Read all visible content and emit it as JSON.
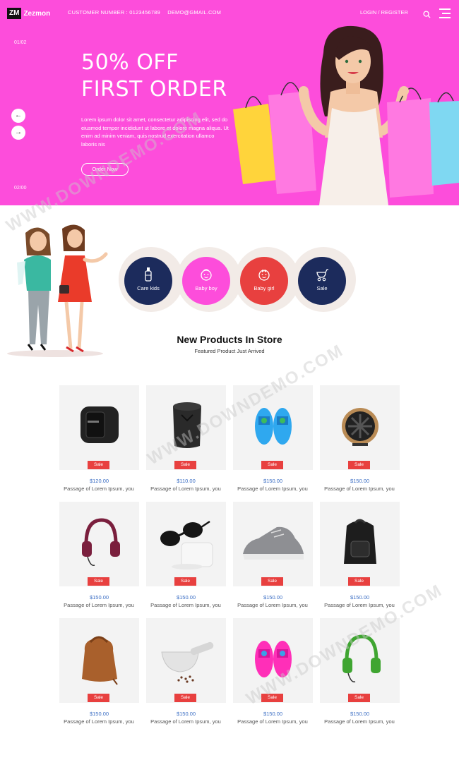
{
  "brand": {
    "mark": "ZM",
    "name": "Zezmon"
  },
  "topbar": {
    "customer_number": "CUSTOMER NUMBER : 0123456789",
    "email": "DEMO@GMAIL.COM",
    "login": "LOGIN / REGISTER"
  },
  "hero": {
    "slide_top": "01/02",
    "slide_bottom": "02/00",
    "title_line1": "50% OFF",
    "title_line2": "FIRST ORDER",
    "text": "Lorem ipsum dolor sit amet, consectetur adipiscing elit, sed do eiusmod tempor incididunt ut labore et dolore magna aliqua. Ut enim ad minim veniam, quis nostrud exercitation ullamco laboris nis",
    "button": "Order Now",
    "prev_arrow": "←",
    "next_arrow": "→"
  },
  "categories": [
    {
      "label": "Care kids",
      "color": "#1c2b5c",
      "icon": "bottle-icon"
    },
    {
      "label": "Baby boy",
      "color": "#fd4ddb",
      "icon": "baby-face-icon"
    },
    {
      "label": "Baby girl",
      "color": "#e8403f",
      "icon": "baby-face-icon"
    },
    {
      "label": "Sale",
      "color": "#1c2b5c",
      "icon": "stroller-icon"
    }
  ],
  "section": {
    "title": "New Products In Store",
    "subtitle": "Featured Product Just Arrived"
  },
  "products": [
    {
      "name": "smartwatch",
      "badge": "Sale",
      "price": "$120.00",
      "desc": "Passage of Lorem Ipsum, you"
    },
    {
      "name": "speaker",
      "badge": "Sale",
      "price": "$110.00",
      "desc": "Passage of Lorem Ipsum, you"
    },
    {
      "name": "blue-slippers",
      "badge": "Sale",
      "price": "$150.00",
      "desc": "Passage of Lorem Ipsum, you"
    },
    {
      "name": "fan",
      "badge": "Sale",
      "price": "$150.00",
      "desc": "Passage of Lorem Ipsum, you"
    },
    {
      "name": "headphones-maroon",
      "badge": "Sale",
      "price": "$150.00",
      "desc": "Passage of Lorem Ipsum, you"
    },
    {
      "name": "sunglasses",
      "badge": "Sale",
      "price": "$150.00",
      "desc": "Passage of Lorem Ipsum, you"
    },
    {
      "name": "sneaker",
      "badge": "Sale",
      "price": "$150.00",
      "desc": "Passage of Lorem Ipsum, you"
    },
    {
      "name": "backpack",
      "badge": "Sale",
      "price": "$150.00",
      "desc": "Passage of Lorem Ipsum, you"
    },
    {
      "name": "leather-bag",
      "badge": "Sale",
      "price": "$150.00",
      "desc": "Passage of Lorem Ipsum, you"
    },
    {
      "name": "mortar",
      "badge": "Sale",
      "price": "$150.00",
      "desc": "Passage of Lorem Ipsum, you"
    },
    {
      "name": "pink-slippers",
      "badge": "Sale",
      "price": "$150.00",
      "desc": "Passage of Lorem Ipsum, you"
    },
    {
      "name": "headphones-green",
      "badge": "Sale",
      "price": "$150.00",
      "desc": "Passage of Lorem Ipsum, you"
    }
  ],
  "watermark": "WWW.DOWNDEMO.COM",
  "colors": {
    "hero_bg": "#fd4ddb",
    "sale_badge": "#e8403f",
    "price": "#3b6ec4",
    "navy": "#1c2b5c"
  }
}
